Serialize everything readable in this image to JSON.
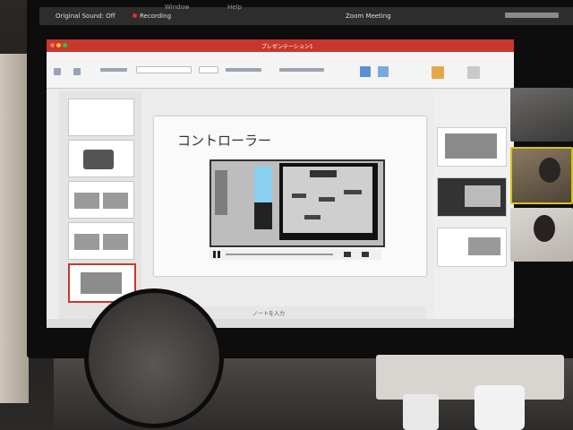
{
  "menubar": {
    "sound_status": "Original Sound: Off",
    "recording": "Recording",
    "window_title": "Zoom Meeting",
    "top_labels": [
      "Window",
      "Help"
    ]
  },
  "powerpoint": {
    "doc_title": "プレゼンテーション1",
    "slide": {
      "title": "コントローラー"
    },
    "notes_label": "ノートを入力"
  },
  "colors": {
    "ppt_accent": "#c8372d",
    "recording_dot": "#e0302a"
  }
}
